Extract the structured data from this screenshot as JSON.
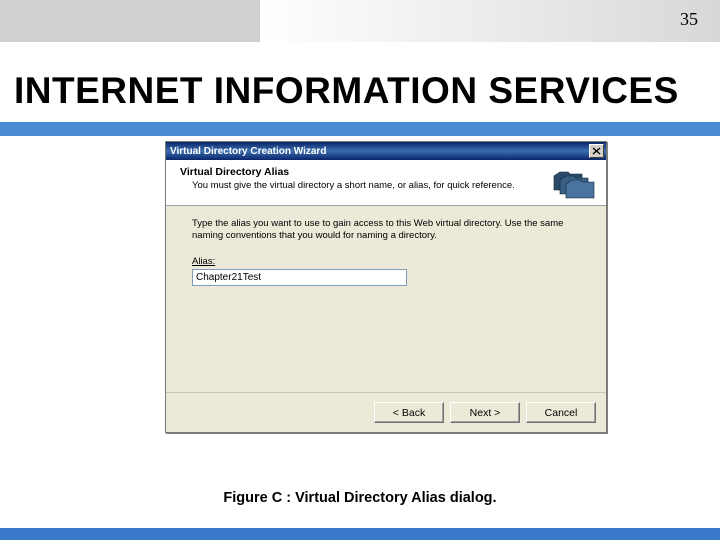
{
  "page_number": "35",
  "slide_title": "INTERNET INFORMATION SERVICES",
  "dialog": {
    "title": "Virtual Directory Creation Wizard",
    "header_title": "Virtual Directory Alias",
    "header_sub": "You must give the virtual directory a short name, or alias, for quick reference.",
    "body_text": "Type the alias you want to use to gain access to this Web virtual directory. Use the same naming conventions that you would for naming a directory.",
    "alias_label": "Alias:",
    "alias_value": "Chapter21Test",
    "buttons": {
      "back": "< Back",
      "next": "Next >",
      "cancel": "Cancel"
    },
    "icons": {
      "close": "close-icon",
      "header": "folder-stack-icon"
    }
  },
  "caption": "Figure C : Virtual Directory Alias dialog."
}
